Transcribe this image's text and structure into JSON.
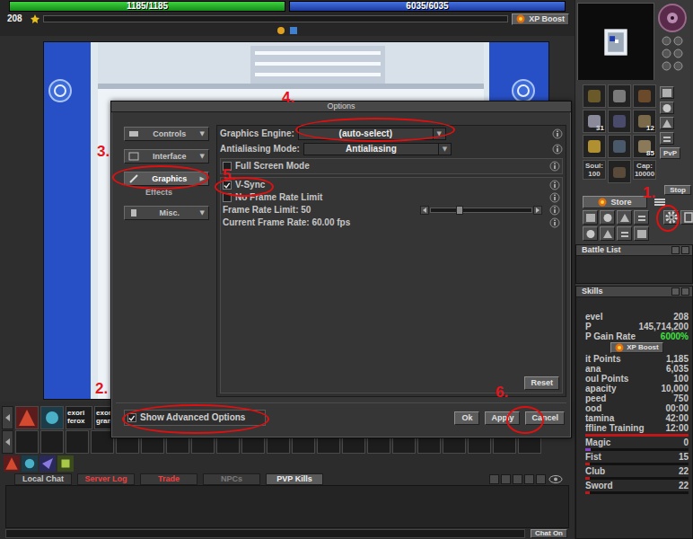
{
  "hud": {
    "health": {
      "text": "1185/1185",
      "level": 1
    },
    "mana": {
      "text": "6035/6035",
      "level": 1
    },
    "level": "208",
    "xp": {
      "level": 0
    },
    "xp_boost": "XP Boost"
  },
  "hotkeys": [
    "exori ferox",
    "exori gran"
  ],
  "chat": {
    "tabs": [
      {
        "label": "Local Chat",
        "selected": false,
        "color": "#c8c8c8"
      },
      {
        "label": "Server Log",
        "selected": false,
        "color": "#f04040"
      },
      {
        "label": "Trade",
        "selected": false,
        "color": "#f04040"
      },
      {
        "label": "NPCs",
        "selected": false,
        "color": "#7a7a7a"
      },
      {
        "label": "PVP Kills",
        "selected": true,
        "color": "#f0f0f0"
      }
    ],
    "toggle": "Chat On"
  },
  "sidebar": {
    "inventory": {
      "counts": [
        "31",
        "12",
        "85"
      ],
      "soul_label": "Soul:",
      "soul": "100",
      "cap_label": "Cap:",
      "cap": "10000"
    },
    "pvp": "PvP",
    "stop": "Stop",
    "store": "Store",
    "battle_list": {
      "title": "Battle List"
    },
    "skills": {
      "title": "Skills",
      "rows": [
        {
          "kind": "row",
          "label": "evel",
          "value": "208"
        },
        {
          "kind": "row",
          "label": "P",
          "value": "145,714,200"
        },
        {
          "kind": "rate",
          "label": "P Gain Rate",
          "value": "6000%"
        },
        {
          "kind": "button",
          "label": "XP Boost"
        },
        {
          "kind": "row",
          "label": "it Points",
          "value": "1,185"
        },
        {
          "kind": "row",
          "label": "ana",
          "value": "6,035"
        },
        {
          "kind": "row",
          "label": "oul Points",
          "value": "100"
        },
        {
          "kind": "row",
          "label": "apacity",
          "value": "10,000"
        },
        {
          "kind": "row",
          "label": "peed",
          "value": "750"
        },
        {
          "kind": "row",
          "label": "ood",
          "value": "00:00"
        },
        {
          "kind": "row",
          "label": "tamina",
          "value": "42:00"
        },
        {
          "kind": "bar",
          "label": "ffline Training",
          "value": "12:00",
          "level": 1,
          "color": "#c01818"
        },
        {
          "kind": "bar",
          "label": "Magic",
          "value": "0",
          "level": 0.05,
          "color": "#8a40c8"
        },
        {
          "kind": "bar",
          "label": "Fist",
          "value": "15",
          "level": 0.04,
          "color": "#c01818"
        },
        {
          "kind": "bar",
          "label": "Club",
          "value": "22",
          "level": 0.04,
          "color": "#c01818"
        },
        {
          "kind": "bar",
          "label": "Sword",
          "value": "22",
          "level": 0.04,
          "color": "#c01818"
        }
      ]
    }
  },
  "dialog": {
    "title": "Options",
    "nav": [
      {
        "kind": "section",
        "label": "Controls",
        "arrow": "▼",
        "selected": false
      },
      {
        "kind": "section",
        "label": "Interface",
        "arrow": "▼",
        "selected": false
      },
      {
        "kind": "section",
        "label": "Graphics",
        "arrow": "▶",
        "selected": true
      },
      {
        "kind": "sub",
        "label": "Effects",
        "selected": false
      },
      {
        "kind": "section",
        "label": "Misc.",
        "arrow": "▼",
        "selected": false
      }
    ],
    "groups": [
      {
        "rows": [
          {
            "kind": "dropdown",
            "label": "Graphics Engine:",
            "value": "(auto-select)",
            "arrow": "▼"
          },
          {
            "kind": "dropdown",
            "label": "Antialiasing Mode:",
            "value": "Antialiasing",
            "arrow": "▼"
          }
        ]
      },
      {
        "rows": [
          {
            "kind": "checkbox",
            "label": "Full Screen Mode",
            "checked": false
          }
        ]
      },
      {
        "rows": [
          {
            "kind": "checkbox",
            "label": "V-Sync",
            "checked": true
          },
          {
            "kind": "checkbox",
            "label": "No Frame Rate Limit",
            "checked": false
          },
          {
            "kind": "slider",
            "label": "Frame Rate Limit: 50",
            "level": 0.27
          },
          {
            "kind": "text",
            "label": "Current Frame Rate: 60.00 fps"
          }
        ]
      }
    ],
    "reset": "Reset",
    "advanced": {
      "label": "Show Advanced Options",
      "checked": true
    },
    "buttons": [
      "Ok",
      "Apply",
      "Cancel"
    ]
  },
  "annotations": [
    {
      "label": "1."
    },
    {
      "label": "2."
    },
    {
      "label": "3."
    },
    {
      "label": "4."
    },
    {
      "label": "5."
    },
    {
      "label": "6."
    }
  ]
}
